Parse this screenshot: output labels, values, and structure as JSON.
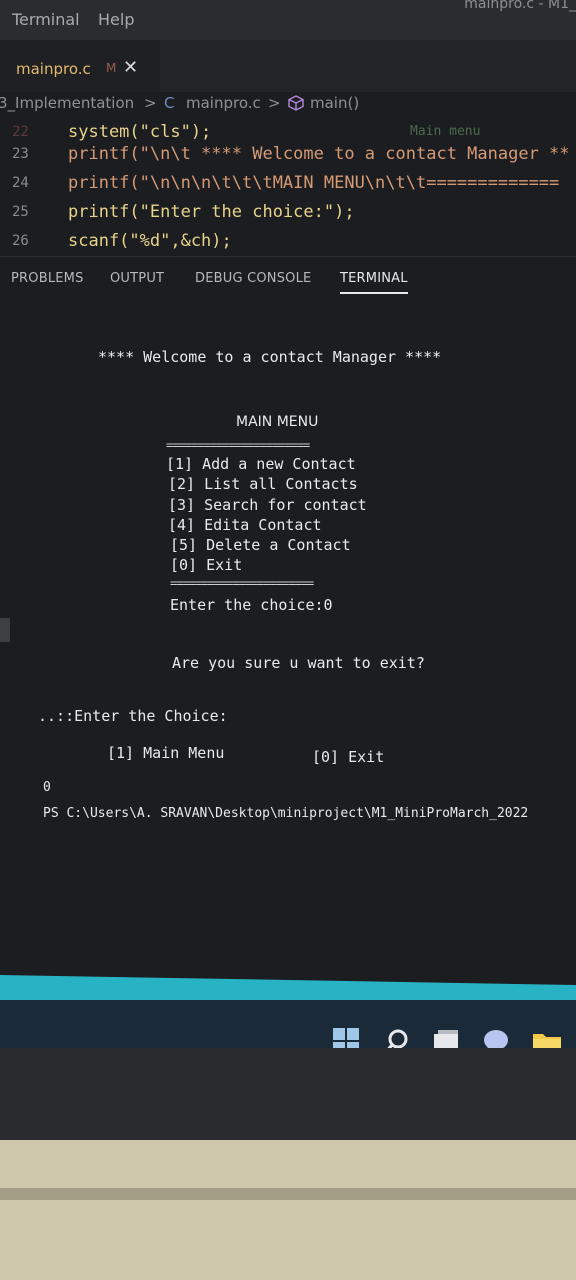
{
  "menubar": {
    "terminal": "Terminal",
    "help": "Help",
    "window_title": "mainpro.c - M1_"
  },
  "tab": {
    "filename": "mainpro.c",
    "modified": "M",
    "close": "✕"
  },
  "breadcrumb": {
    "folder": "3_Implementation",
    "sep1": ">",
    "c_icon": "C",
    "file": "mainpro.c",
    "sep2": ">",
    "func": "main()"
  },
  "editor": {
    "lines": [
      {
        "num": "22",
        "code": "system(\"cls\");",
        "comment": "Main menu"
      },
      {
        "num": "23",
        "code": "printf(\"\\n\\t **** Welcome to a contact Manager **"
      },
      {
        "num": "24",
        "code": "printf(\"\\n\\n\\n\\t\\t\\tMAIN MENU\\n\\t\\t============="
      },
      {
        "num": "25",
        "code": "printf(\"Enter the choice:\");"
      },
      {
        "num": "26",
        "code": "scanf(\"%d\",&ch);"
      }
    ]
  },
  "panel_tabs": [
    "PROBLEMS",
    "OUTPUT",
    "DEBUG CONSOLE",
    "TERMINAL"
  ],
  "terminal": {
    "welcome": "**** Welcome to a contact Manager ****",
    "menu_title": "MAIN MENU",
    "separator": "=======================",
    "options": [
      "[1] Add a new Contact",
      "[2] List all Contacts",
      "[3] Search for contact",
      "[4] Edita Contact",
      "[5] Delete a Contact",
      "[0] Exit"
    ],
    "prompt": "Enter the choice:0",
    "confirm": "Are you sure u want to exit?",
    "enter_choice": "..::Enter the Choice:",
    "main_menu": "[1] Main Menu",
    "exit": "[0] Exit",
    "zero": "0",
    "ps_path": "PS C:\\Users\\A. SRAVAN\\Desktop\\miniproject\\M1_MiniProMarch_2022"
  }
}
